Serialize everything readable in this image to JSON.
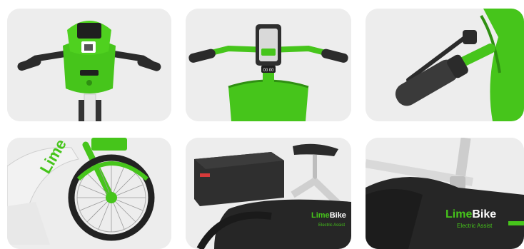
{
  "tiles": [
    {
      "name": "front-handlebar-view"
    },
    {
      "name": "rider-handlebar-view"
    },
    {
      "name": "grip-closeup-view"
    },
    {
      "name": "front-wheel-view"
    },
    {
      "name": "rear-box-view"
    },
    {
      "name": "frame-logo-view"
    }
  ],
  "branding": {
    "front_logo": "Lime",
    "frame_logo": "LimeBike",
    "frame_logo_lime": "Lime",
    "frame_logo_bike": "Bike",
    "frame_sub": "Electric Assist",
    "mount_display": "00 00"
  },
  "colors": {
    "lime_green": "#46c51b",
    "dark_green": "#2f8f12",
    "frame_black": "#2a2a2a",
    "tile_bg": "#ececec"
  }
}
